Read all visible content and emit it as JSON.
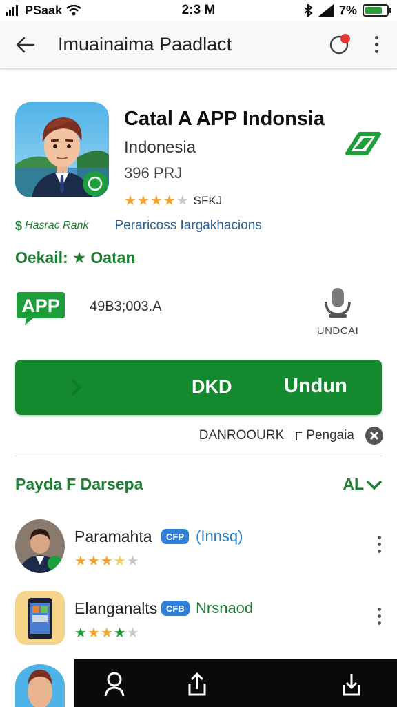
{
  "status_bar": {
    "carrier": "PSaak",
    "time": "2:3 M",
    "battery": "7%"
  },
  "app_bar": {
    "title": "Imuainaima Paadlact"
  },
  "app": {
    "title": "Catal A APP Indonsia",
    "subtitle": "Indonesia",
    "size": "396 PRJ",
    "rating_stars": 4,
    "rating_text": "SFKJ",
    "accent_color": "#148a2f"
  },
  "meta": {
    "left_label": "Hasrac Rank",
    "right_label": "Peraricoss Iargakhacions"
  },
  "section": {
    "label": "Oekail:",
    "star": "★",
    "value": "Oatan"
  },
  "info": {
    "badge_text": "APP",
    "value": "49B3;003.A",
    "mic_label": "UNDCAI"
  },
  "action": {
    "left_label": "DKD",
    "right_label": "Undun"
  },
  "secondary": {
    "left_label": "DANROOURK",
    "right_label": "Pengaia"
  },
  "similar": {
    "title": "Payda F Darsepa",
    "see_all": "AL",
    "items": [
      {
        "name": "Paramahta",
        "badge": "CFP",
        "tag": "(Innsq)",
        "tag_color": "#2a7fc4",
        "stars": 3.5,
        "star_color": "#f0a32c"
      },
      {
        "name": "Elanganalts",
        "badge": "CFB",
        "tag": "Nrsnaod",
        "tag_color": "#1e7e34",
        "stars": 4,
        "star_color": "#1e9e3a"
      }
    ]
  },
  "bottom_nav": {
    "items": [
      "profile-icon",
      "share-icon",
      "download-icon"
    ]
  }
}
